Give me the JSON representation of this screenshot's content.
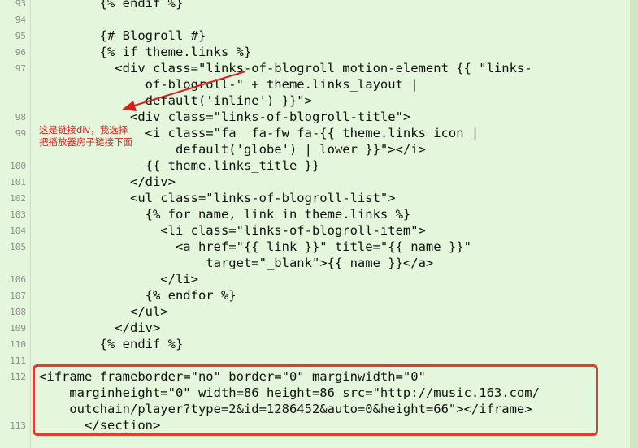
{
  "gutter": {
    "numbers": [
      "93",
      "94",
      "95",
      "96",
      "97",
      "98",
      "99",
      "100",
      "101",
      "102",
      "103",
      "104",
      "105",
      "106",
      "107",
      "108",
      "109",
      "110",
      "111",
      "112",
      "113"
    ]
  },
  "code": {
    "lines": [
      "        {% endif %}",
      "",
      "        {# Blogroll #}",
      "        {% if theme.links %}",
      "          <div class=\"links-of-blogroll motion-element {{ \"links-",
      "              of-blogroll-\" + theme.links_layout |",
      "              default('inline') }}\">",
      "            <div class=\"links-of-blogroll-title\">",
      "              <i class=\"fa  fa-fw fa-{{ theme.links_icon |",
      "                  default('globe') | lower }}\"></i>",
      "              {{ theme.links_title }}",
      "            </div>",
      "            <ul class=\"links-of-blogroll-list\">",
      "              {% for name, link in theme.links %}",
      "                <li class=\"links-of-blogroll-item\">",
      "                  <a href=\"{{ link }}\" title=\"{{ name }}\"",
      "                      target=\"_blank\">{{ name }}</a>",
      "                </li>",
      "              {% endfor %}",
      "            </ul>",
      "          </div>",
      "        {% endif %}",
      "",
      "<iframe frameborder=\"no\" border=\"0\" marginwidth=\"0\"",
      "    marginheight=\"0\" width=86 height=86 src=\"http://music.163.com/",
      "    outchain/player?type=2&id=1286452&auto=0&height=66\"></iframe>",
      "      </section>"
    ]
  },
  "annotation": {
    "line1": "这是链接div，我选择",
    "line2": "把播放器房子链接下面"
  },
  "colors": {
    "background": "#e4f6db",
    "annotation": "#d82020",
    "highlight_box": "#e53b31"
  }
}
